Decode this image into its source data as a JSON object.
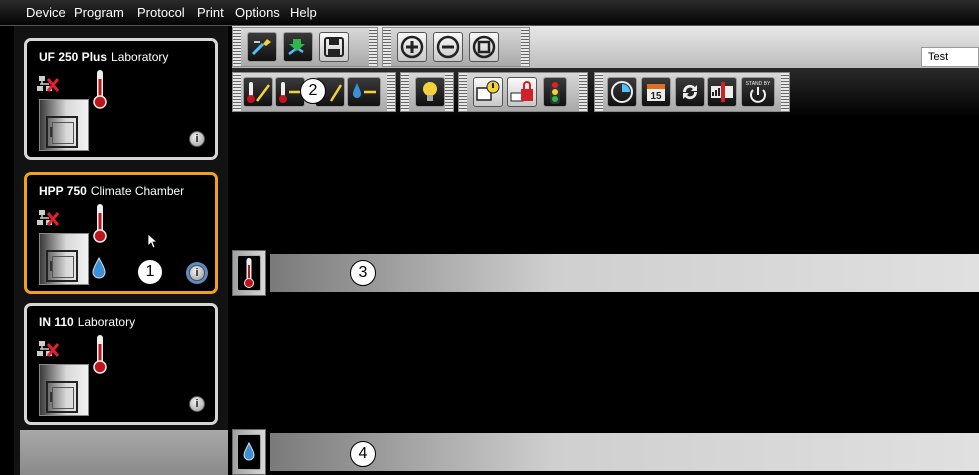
{
  "menu": [
    "Device",
    "Program",
    "Protocol",
    "Print",
    "Options",
    "Help"
  ],
  "devices": [
    {
      "model": "UF 250 Plus",
      "type": "Laboratory",
      "selected": false,
      "has_humidity": false
    },
    {
      "model": "HPP 750",
      "type": "Climate Chamber",
      "selected": true,
      "has_humidity": true
    },
    {
      "model": "IN 110",
      "type": "Laboratory",
      "selected": false,
      "has_humidity": false
    }
  ],
  "callouts": [
    "1",
    "2",
    "3",
    "4"
  ],
  "info_glyph": "i",
  "test_field": "Test",
  "toolbar1": [
    "open-program-icon",
    "save-to-device-icon",
    "floppy-disk-icon",
    "zoom-in-icon",
    "zoom-out-icon",
    "zoom-fit-icon"
  ],
  "toolbar2": [
    "temperature-ramp-icon",
    "temperature-hold-icon",
    "humidity-ramp-icon",
    "humidity-hold-icon",
    "light-bulb-icon",
    "alarm-message-icon",
    "lock-icon",
    "traffic-light-icon",
    "timer-icon",
    "calendar-icon",
    "loop-icon",
    "fan-speed-icon",
    "standby-icon"
  ],
  "standby_label": "STAND BY",
  "calendar_day": "15",
  "strips": [
    "temperature",
    "humidity"
  ],
  "colors": {
    "selected_border": "#f2a21a",
    "thermometer": "#c0141c",
    "drop": "#3a8fd9",
    "badge_ring": "#5d8cc4"
  }
}
